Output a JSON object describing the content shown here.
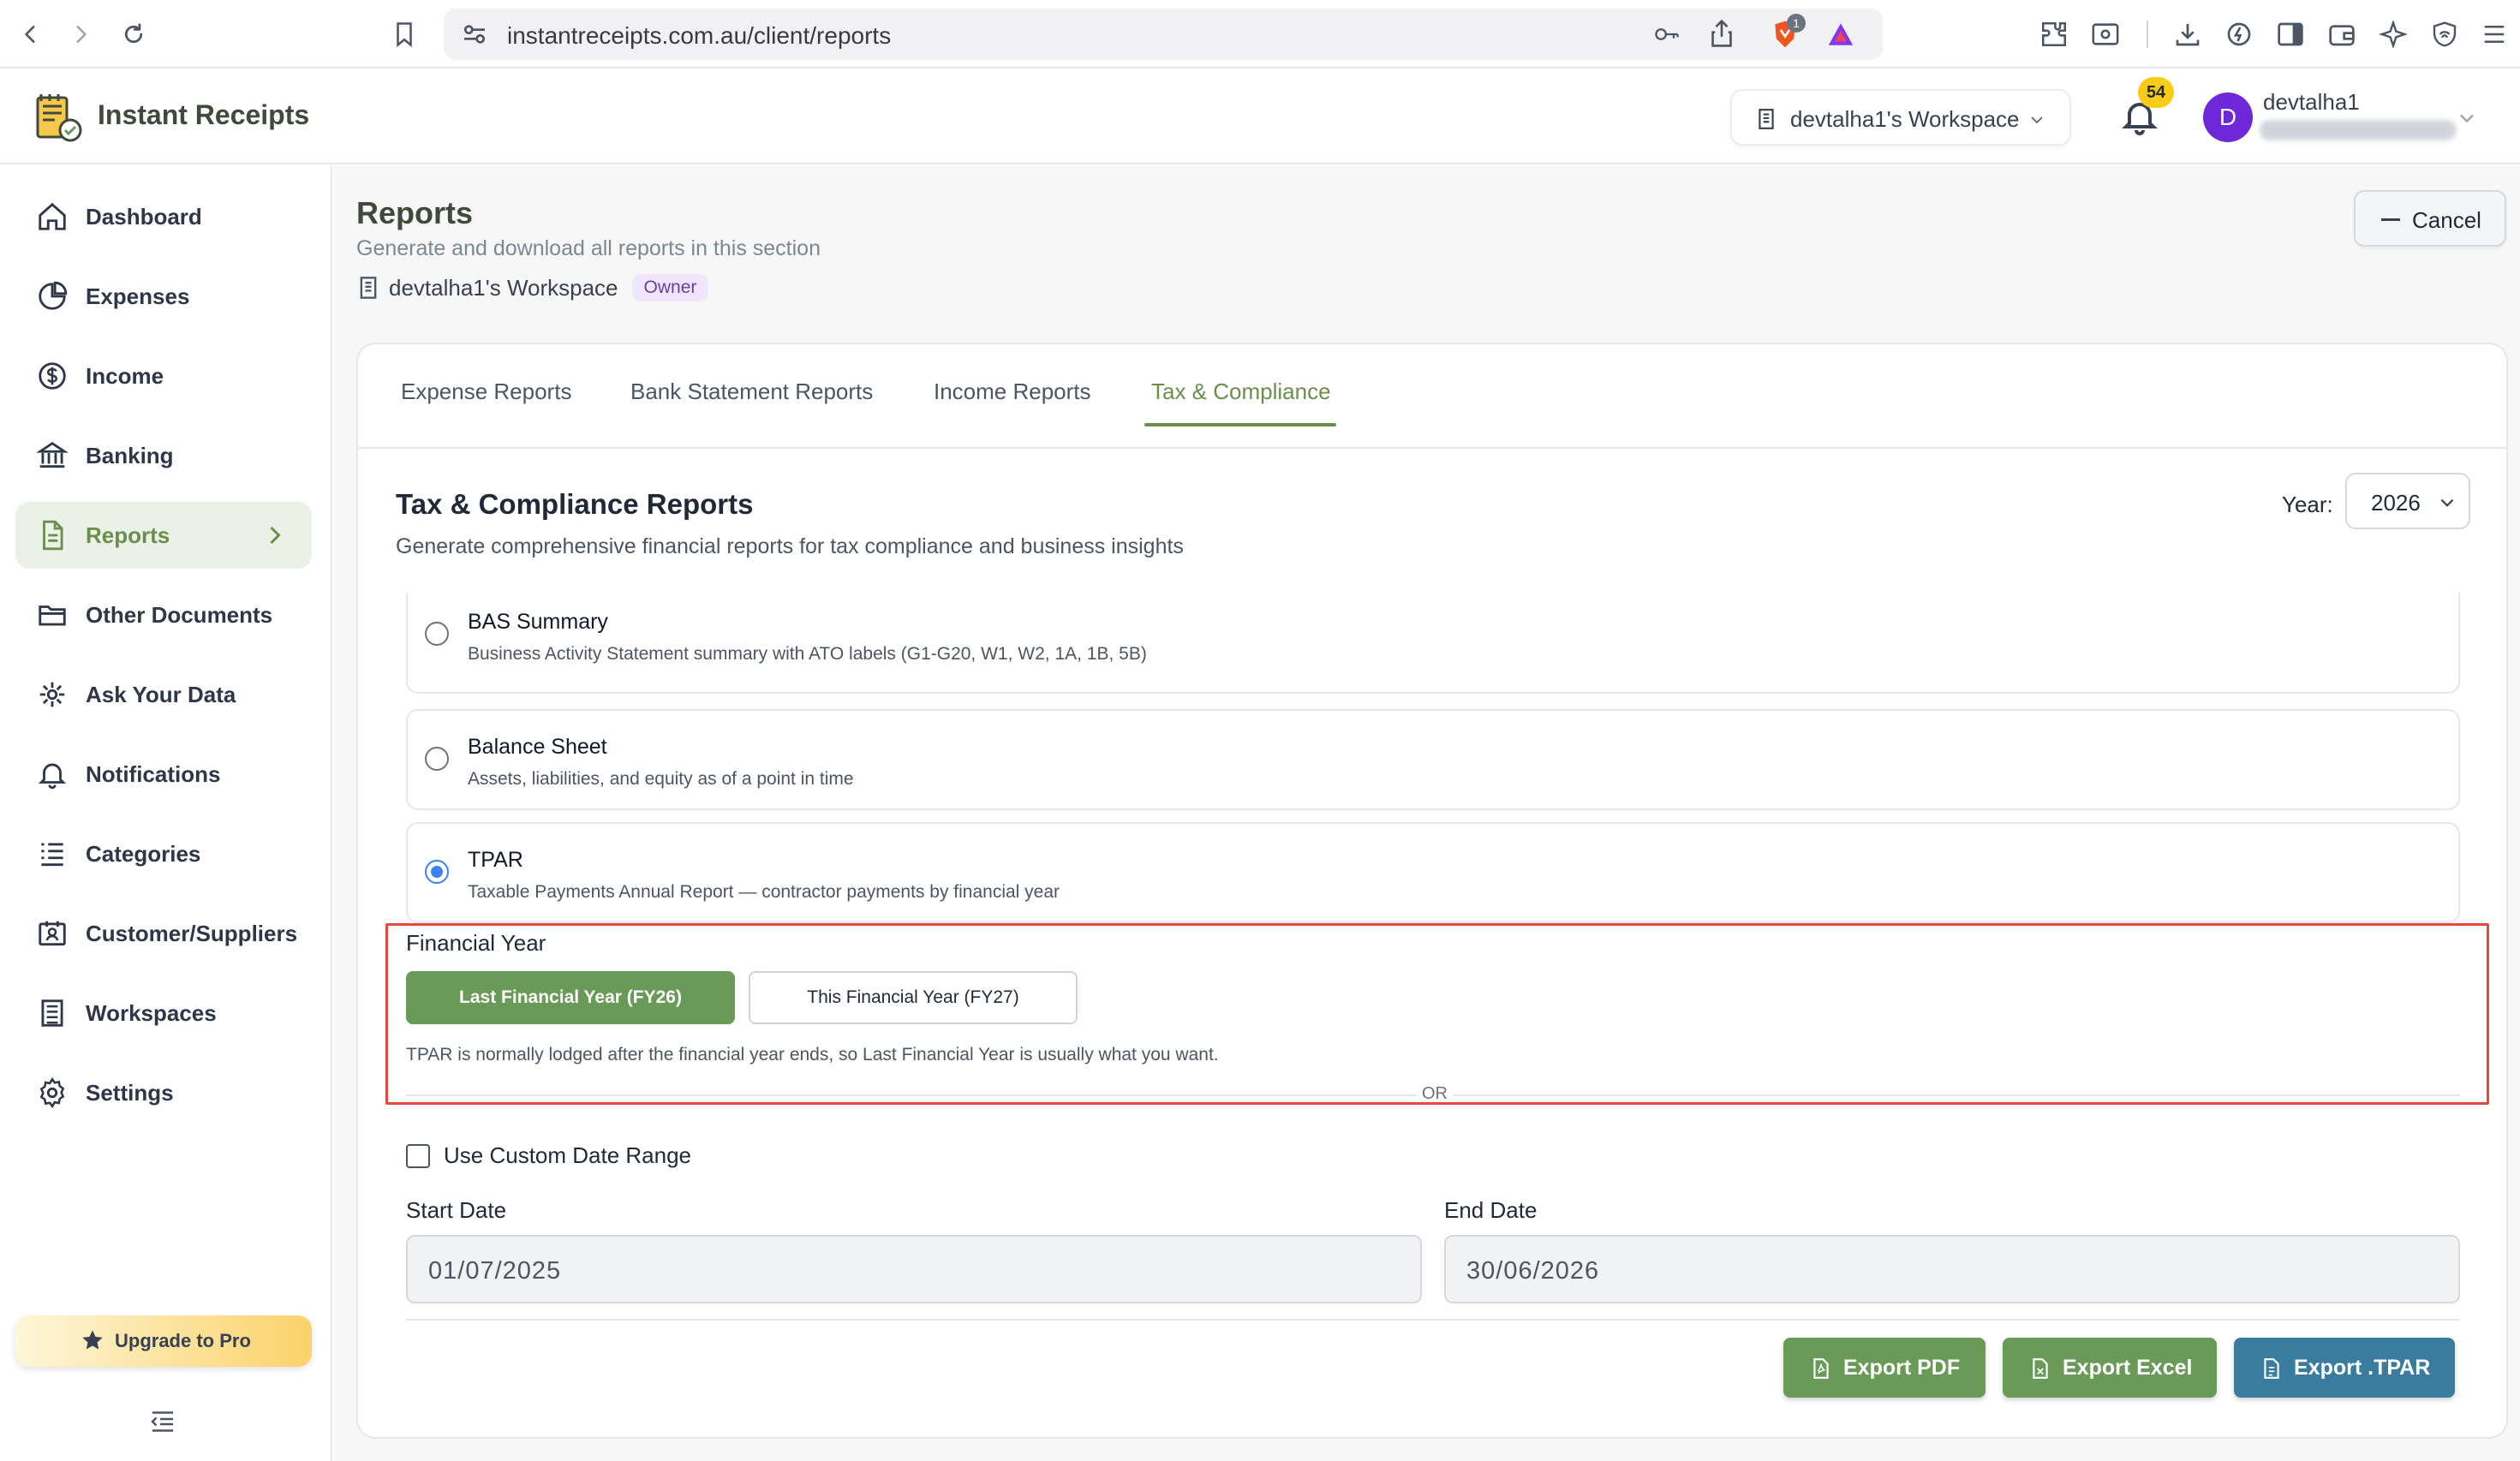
{
  "browser": {
    "url": "instantreceipts.com.au/client/reports",
    "brave_badge": "1"
  },
  "header": {
    "brand": "Instant Receipts",
    "workspace_selector": "devtalha1's Workspace",
    "notification_count": "54",
    "avatar_initial": "D",
    "username": "devtalha1"
  },
  "sidebar": {
    "items": [
      {
        "label": "Dashboard",
        "icon": "home-icon"
      },
      {
        "label": "Expenses",
        "icon": "pie-chart-icon"
      },
      {
        "label": "Income",
        "icon": "dollar-circle-icon"
      },
      {
        "label": "Banking",
        "icon": "bank-icon"
      },
      {
        "label": "Reports",
        "icon": "document-icon"
      },
      {
        "label": "Other Documents",
        "icon": "folder-icon"
      },
      {
        "label": "Ask Your Data",
        "icon": "ai-spark-icon"
      },
      {
        "label": "Notifications",
        "icon": "bell-icon"
      },
      {
        "label": "Categories",
        "icon": "list-icon"
      },
      {
        "label": "Customer/Suppliers",
        "icon": "contacts-icon"
      },
      {
        "label": "Workspaces",
        "icon": "building-icon"
      },
      {
        "label": "Settings",
        "icon": "gear-icon"
      }
    ],
    "upgrade_label": "Upgrade to Pro"
  },
  "page": {
    "title": "Reports",
    "subtitle": "Generate and download all reports in this section",
    "workspace": "devtalha1's Workspace",
    "role_badge": "Owner",
    "cancel_label": "Cancel"
  },
  "tabs": [
    {
      "label": "Expense Reports"
    },
    {
      "label": "Bank Statement Reports"
    },
    {
      "label": "Income Reports"
    },
    {
      "label": "Tax & Compliance"
    }
  ],
  "section": {
    "title": "Tax & Compliance Reports",
    "subtitle": "Generate comprehensive financial reports for tax compliance and business insights",
    "year_label": "Year:",
    "year_value": "2026"
  },
  "options": [
    {
      "title": "BAS Summary",
      "desc": "Business Activity Statement summary with ATO labels (G1-G20, W1, W2, 1A, 1B, 5B)",
      "selected": false
    },
    {
      "title": "Balance Sheet",
      "desc": "Assets, liabilities, and equity as of a point in time",
      "selected": false
    },
    {
      "title": "TPAR",
      "desc": "Taxable Payments Annual Report — contractor payments by financial year",
      "selected": true
    }
  ],
  "financial_year": {
    "label": "Financial Year",
    "last_fy": "Last Financial Year (FY26)",
    "this_fy": "This Financial Year (FY27)",
    "note": "TPAR is normally lodged after the financial year ends, so Last Financial Year is usually what you want.",
    "or": "OR"
  },
  "custom_range": {
    "checkbox_label": "Use Custom Date Range",
    "start_label": "Start Date",
    "start_value": "01/07/2025",
    "end_label": "End Date",
    "end_value": "30/06/2026"
  },
  "exports": {
    "pdf": "Export PDF",
    "excel": "Export Excel",
    "tpar": "Export .TPAR"
  },
  "colors": {
    "accent_green": "#6a9a58",
    "accent_blue": "#3a7ca0",
    "highlight_red": "#e5483c"
  }
}
